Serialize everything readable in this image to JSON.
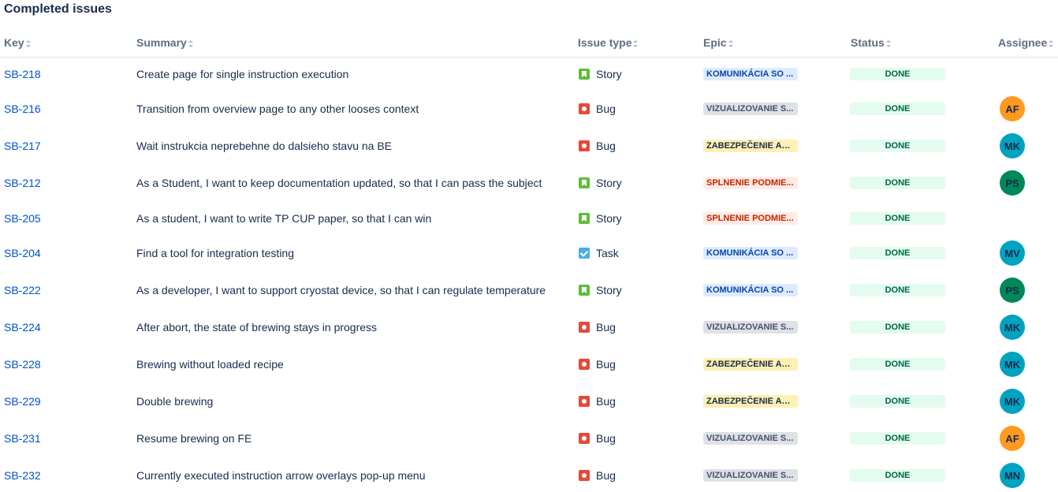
{
  "title": "Completed issues",
  "columns": {
    "key": "Key",
    "summary": "Summary",
    "issue_type": "Issue type",
    "epic": "Epic",
    "status": "Status",
    "assignee": "Assignee"
  },
  "epic_colors": {
    "blue": "#deebff",
    "grey": "#dfe1e6",
    "yellow": "#fff0b3",
    "red": "#ffebe6"
  },
  "avatar_colors": {
    "AF": "#ff991f",
    "MK": "#00a3bf",
    "PS": "#00875a",
    "MV": "#00a3bf",
    "MN": "#00a3bf"
  },
  "issues": [
    {
      "key": "SB-218",
      "summary": "Create page for single instruction execution",
      "type": "Story",
      "type_icon": "story-icon",
      "epic": "KOMUNIKÁCIA SO ...",
      "epic_color": "blue",
      "status": "DONE",
      "assignee": ""
    },
    {
      "key": "SB-216",
      "summary": "Transition from overview page to any other looses context",
      "type": "Bug",
      "type_icon": "bug-icon",
      "epic": "VIZUALIZOVANIE S...",
      "epic_color": "grey",
      "status": "DONE",
      "assignee": "AF"
    },
    {
      "key": "SB-217",
      "summary": "Wait instrukcia neprebehne do dalsieho stavu na BE",
      "type": "Bug",
      "type_icon": "bug-icon",
      "epic": "ZABEZPEČENIE AUT...",
      "epic_color": "yellow",
      "status": "DONE",
      "assignee": "MK"
    },
    {
      "key": "SB-212",
      "summary": "As a Student, I want to keep documentation updated, so that I can pass the subject",
      "type": "Story",
      "type_icon": "story-icon",
      "epic": "SPLNENIE PODMIE...",
      "epic_color": "red",
      "status": "DONE",
      "assignee": "PS"
    },
    {
      "key": "SB-205",
      "summary": "As a student, I want to write TP CUP paper, so that I can win",
      "type": "Story",
      "type_icon": "story-icon",
      "epic": "SPLNENIE PODMIE...",
      "epic_color": "red",
      "status": "DONE",
      "assignee": ""
    },
    {
      "key": "SB-204",
      "summary": "Find a tool for integration testing",
      "type": "Task",
      "type_icon": "task-icon",
      "epic": "KOMUNIKÁCIA SO ...",
      "epic_color": "blue",
      "status": "DONE",
      "assignee": "MV"
    },
    {
      "key": "SB-222",
      "summary": "As a developer, I want to support cryostat device, so that I can regulate temperature",
      "type": "Story",
      "type_icon": "story-icon",
      "epic": "KOMUNIKÁCIA SO ...",
      "epic_color": "blue",
      "status": "DONE",
      "assignee": "PS"
    },
    {
      "key": "SB-224",
      "summary": "After abort, the state of brewing stays in progress",
      "type": "Bug",
      "type_icon": "bug-icon",
      "epic": "VIZUALIZOVANIE S...",
      "epic_color": "grey",
      "status": "DONE",
      "assignee": "MK"
    },
    {
      "key": "SB-228",
      "summary": "Brewing without loaded recipe",
      "type": "Bug",
      "type_icon": "bug-icon",
      "epic": "ZABEZPEČENIE AUT...",
      "epic_color": "yellow",
      "status": "DONE",
      "assignee": "MK"
    },
    {
      "key": "SB-229",
      "summary": "Double brewing",
      "type": "Bug",
      "type_icon": "bug-icon",
      "epic": "ZABEZPEČENIE AUT...",
      "epic_color": "yellow",
      "status": "DONE",
      "assignee": "MK"
    },
    {
      "key": "SB-231",
      "summary": "Resume brewing on FE",
      "type": "Bug",
      "type_icon": "bug-icon",
      "epic": "VIZUALIZOVANIE S...",
      "epic_color": "grey",
      "status": "DONE",
      "assignee": "AF"
    },
    {
      "key": "SB-232",
      "summary": "Currently executed instruction arrow overlays pop-up menu",
      "type": "Bug",
      "type_icon": "bug-icon",
      "epic": "VIZUALIZOVANIE S...",
      "epic_color": "grey",
      "status": "DONE",
      "assignee": "MN"
    }
  ]
}
